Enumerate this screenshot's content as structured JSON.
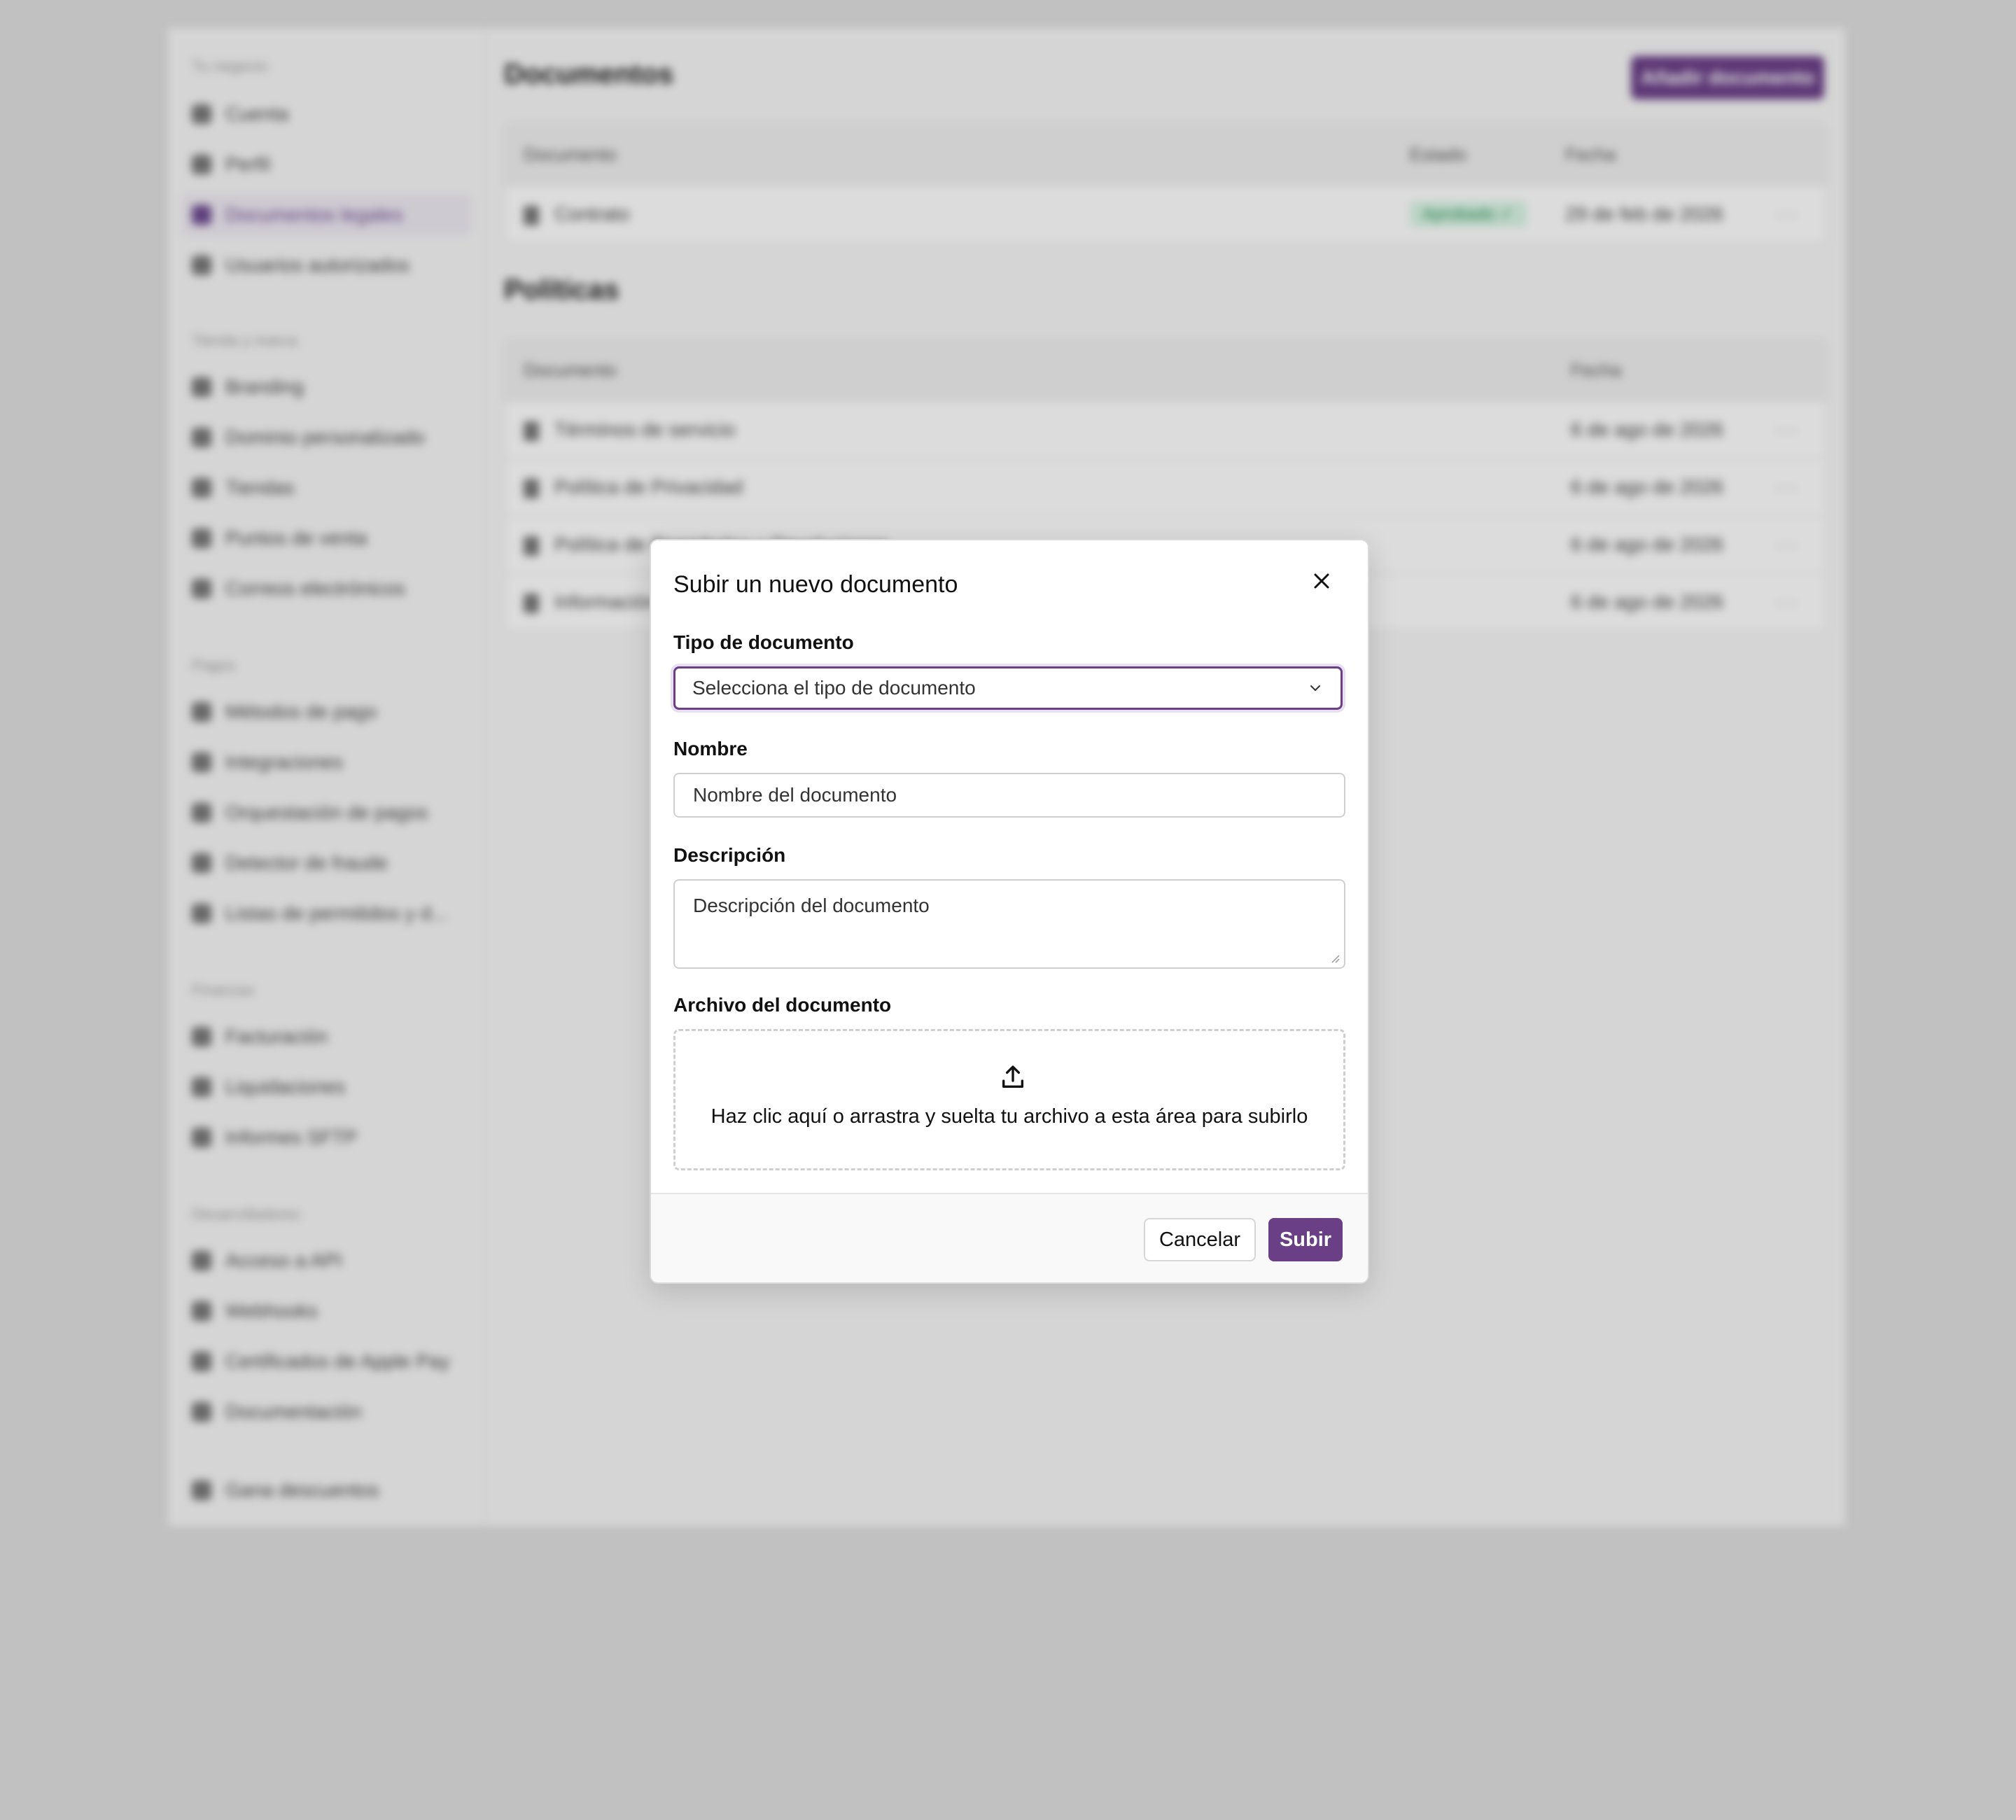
{
  "sidebar": {
    "groups": [
      {
        "title": "Tu negocio",
        "items": [
          "Cuenta",
          "Perfil",
          "Documentos legales",
          "Usuarios autorizados"
        ]
      },
      {
        "title": "Tienda y marca",
        "items": [
          "Branding",
          "Dominio personalizado",
          "Tiendas",
          "Puntos de venta",
          "Correos electrónicos"
        ]
      },
      {
        "title": "Pagos",
        "items": [
          "Métodos de pago",
          "Integraciones",
          "Orquestación de pagos",
          "Detector de fraude",
          "Listas de permitidos y d..."
        ]
      },
      {
        "title": "Finanzas",
        "items": [
          "Facturación",
          "Liquidaciones",
          "Informes SFTP"
        ]
      },
      {
        "title": "Desarrolladores",
        "items": [
          "Acceso a API",
          "Webhooks",
          "Certificados de Apple Pay",
          "Documentación"
        ]
      }
    ],
    "footer_item": "Gana descuentos",
    "active_item": "Documentos legales"
  },
  "main": {
    "documents_title": "Documentos",
    "add_button": "Añadir documento",
    "documents_table": {
      "headers": [
        "Documento",
        "Estado",
        "Fecha"
      ],
      "rows": [
        {
          "name": "Contrato",
          "status": "Aprobado ✓",
          "date": "29 de feb de 2026"
        }
      ]
    },
    "policies_title": "Políticas",
    "policies_table": {
      "headers": [
        "Documento",
        "Fecha"
      ],
      "rows": [
        {
          "name": "Términos de servicio",
          "date": "6 de ago de 2026"
        },
        {
          "name": "Política de Privacidad",
          "date": "6 de ago de 2026"
        },
        {
          "name": "Política de Reembolso y Devoluciones",
          "date": "6 de ago de 2026"
        },
        {
          "name": "Información de la empresa",
          "date": "6 de ago de 2026"
        }
      ]
    }
  },
  "modal": {
    "title": "Subir un nuevo documento",
    "type_label": "Tipo de documento",
    "type_placeholder": "Selecciona el tipo de documento",
    "name_label": "Nombre",
    "name_placeholder": "Nombre del documento",
    "description_label": "Descripción",
    "description_placeholder": "Descripción del documento",
    "file_label": "Archivo del documento",
    "dropzone_text": "Haz clic aquí o arrastra y suelta tu archivo a esta área para subirlo",
    "cancel_label": "Cancelar",
    "submit_label": "Subir"
  },
  "colors": {
    "accent": "#6a3f86",
    "page_background": "#dcdcdc",
    "status_green": "#2c8f57"
  }
}
